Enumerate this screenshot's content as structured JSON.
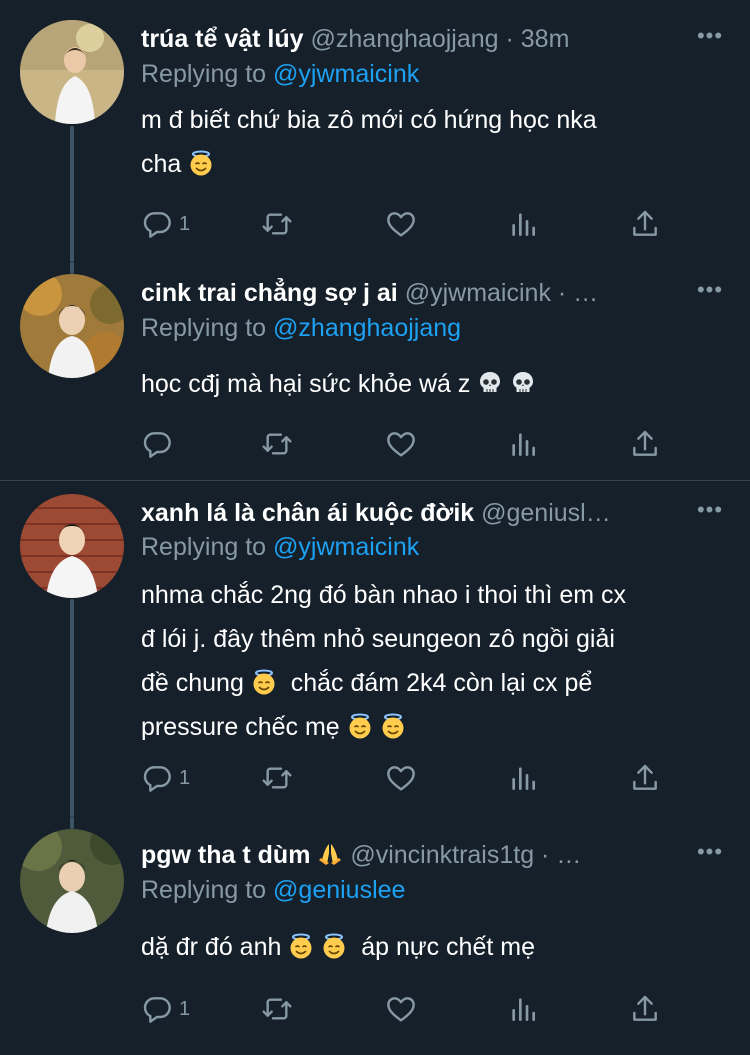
{
  "tweets": [
    {
      "name": "trúa tể vật lúy",
      "handle": "@zhanghaojjang · 38m",
      "replying_prefix": "Replying to",
      "replying_to": "@yjwmaicink",
      "text_line1": "m đ biết chứ bia zô mới có hứng học nka",
      "text_line2": "cha",
      "reply_count": "1",
      "emojis": [
        "angel-emoji"
      ]
    },
    {
      "name": "cink trai chẳng sợ j ai",
      "handle": "@yjwmaicink · …",
      "replying_prefix": "Replying to",
      "replying_to": "@zhanghaojjang",
      "text_line1": "học cđj mà hại sức khỏe wá z",
      "reply_count": "",
      "emojis": [
        "skull-emoji",
        "skull-emoji"
      ]
    },
    {
      "name": "xanh lá là chân ái kuộc đời",
      "name_tail": "k",
      "handle": "@geniusl…",
      "replying_prefix": "Replying to",
      "replying_to": "@yjwmaicink",
      "text_line1": "nhma chắc 2ng đó bàn nhao i thoi thì em cx",
      "text_line2": "đ lói j. đây thêm nhỏ seungeon zô ngồi giải",
      "text_line3a": "đề chung",
      "text_line3b": "chắc đám 2k4 còn lại cx pể",
      "text_line4": "pressure chếc mẹ",
      "reply_count": "1",
      "emojis": [
        "angel-emoji",
        "angel-emoji",
        "angel-emoji"
      ]
    },
    {
      "name": "pgw tha t dùm",
      "handle": "@vincinktrais1tg · …",
      "replying_prefix": "Replying to",
      "replying_to": "@geniuslee",
      "text_line1a": "dặ đr đó anh",
      "text_line1b": "áp nực chết mẹ",
      "reply_count": "1",
      "emojis": [
        "folded-hands-emoji",
        "angel-emoji",
        "angel-emoji"
      ]
    }
  ],
  "more_label": "•••",
  "colors": {
    "background": "#15202b",
    "secondary_text": "#8899a6",
    "link": "#1da1f2",
    "divider": "#38444d"
  },
  "action_icons": [
    "reply-icon",
    "retweet-icon",
    "like-icon",
    "analytics-icon",
    "share-icon"
  ]
}
